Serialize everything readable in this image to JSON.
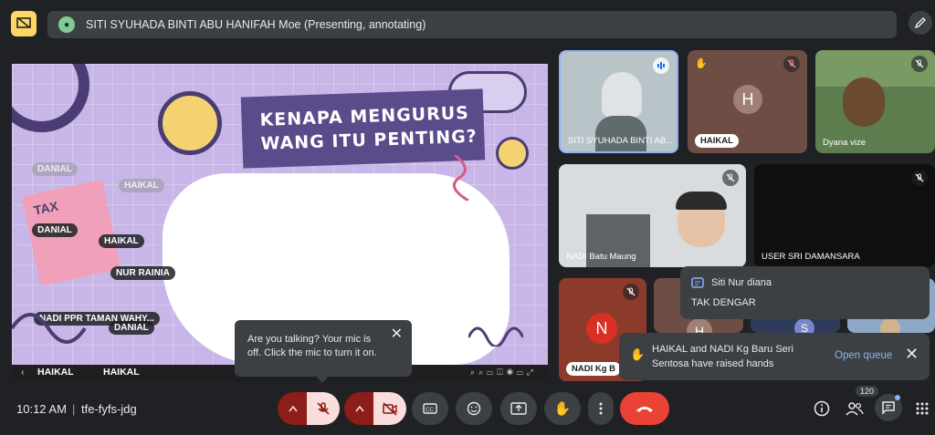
{
  "header": {
    "presenter_text": "SITI SYUHADA BINTI ABU HANIFAH Moe (Presenting, annotating)"
  },
  "slide": {
    "title_line1": "KENAPA MENGURUS",
    "title_line2": "WANG ITU PENTING?",
    "tax_text": "TAX",
    "annotations": [
      {
        "label": "DANIAL",
        "faded": true
      },
      {
        "label": "HAIKAL",
        "faded": true
      },
      {
        "label": "DANIAL",
        "faded": false
      },
      {
        "label": "HAIKAL",
        "faded": false
      },
      {
        "label": "NUR RAINIA",
        "faded": false
      },
      {
        "label": "NADI PPR TAMAN WAHY...",
        "faded": false
      },
      {
        "label": "DANIAL",
        "faded": false
      }
    ],
    "bottom_labels": [
      "HAIKAL",
      "HAIKAL"
    ]
  },
  "mic_tooltip": {
    "text": "Are you talking? Your mic is off. Click the mic to turn it on.",
    "close": "✕"
  },
  "tiles": [
    {
      "name": "SITI SYUHADA BINTI AB..."
    },
    {
      "name": "HAIKAL",
      "initial": "H"
    },
    {
      "name": "Dyana vize"
    },
    {
      "name": "NADI Batu Maung"
    },
    {
      "name": "USER SRI DAMANSARA"
    },
    {
      "name": "NADI Kg B",
      "initial": "N"
    },
    {
      "initial": "H"
    },
    {
      "initial": "S"
    }
  ],
  "chat_notification": {
    "sender": "Siti Nur diana",
    "message": "TAK DENGAR"
  },
  "hands_notification": {
    "text": "HAIKAL and NADI Kg Baru Seri Sentosa have raised hands",
    "action": "Open queue",
    "close": "✕"
  },
  "bottom_bar": {
    "time": "10:12 AM",
    "separator": "|",
    "meeting_code": "tfe-fyfs-jdg",
    "participant_count": "120"
  },
  "colors": {
    "background": "#202124",
    "control_dark": "#3c4043",
    "end_call": "#ea4335",
    "slide_bg": "#c8b6e8",
    "accent_blue": "#8ab4f8"
  }
}
